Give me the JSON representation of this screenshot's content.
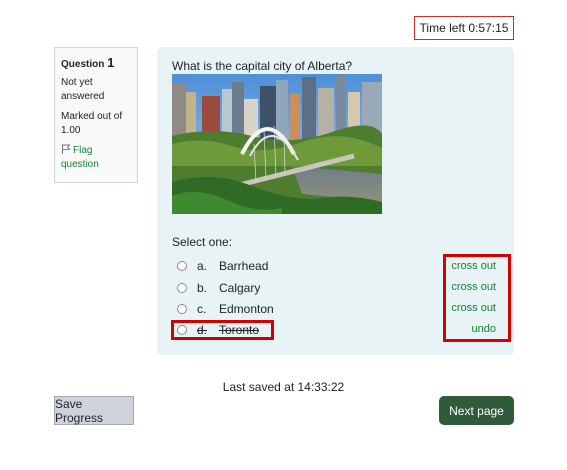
{
  "timer": {
    "label": "Time left 0:57:15"
  },
  "question_info": {
    "heading": "Question",
    "number": "1",
    "state": "Not yet answered",
    "grade": "Marked out of 1.00",
    "flag_label": "Flag question"
  },
  "question": {
    "text": "What is the capital city of Alberta?",
    "select_label": "Select one:",
    "options": [
      {
        "letter": "a.",
        "text": "Barrhead",
        "action": "cross out",
        "struck": false
      },
      {
        "letter": "b.",
        "text": "Calgary",
        "action": "cross out",
        "struck": false
      },
      {
        "letter": "c.",
        "text": "Edmonton",
        "action": "cross out",
        "struck": false
      },
      {
        "letter": "d.",
        "text": "Toronto",
        "action": "undo",
        "struck": true
      }
    ]
  },
  "footer": {
    "last_saved": "Last saved at 14:33:22",
    "save_label": "Save Progress",
    "next_label": "Next page"
  }
}
